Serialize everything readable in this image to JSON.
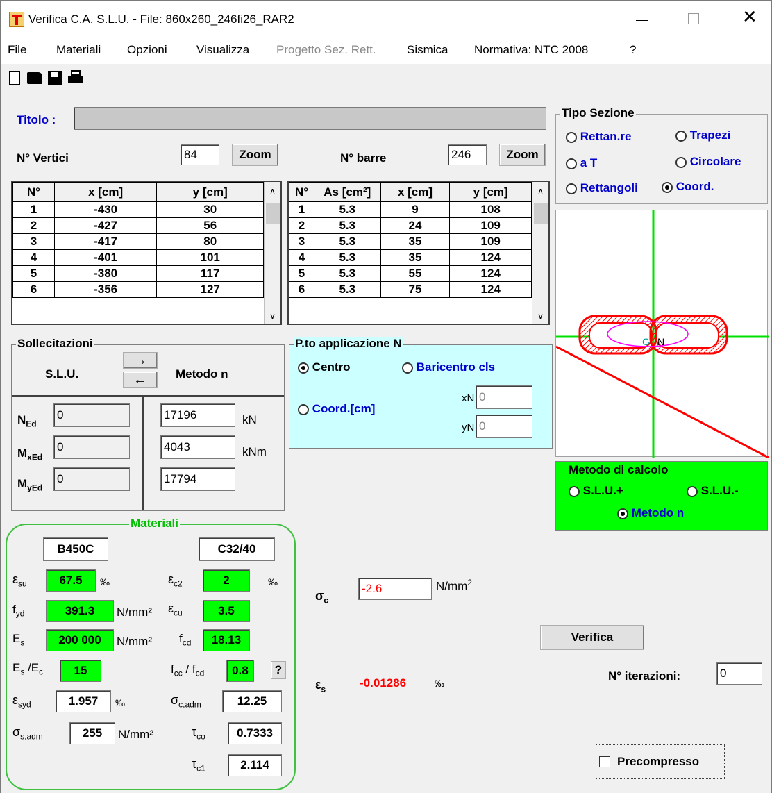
{
  "window": {
    "title": "Verifica C.A. S.L.U. - File: 860x260_246fi26_RAR2"
  },
  "menu": [
    "File",
    "Materiali",
    "Opzioni",
    "Visualizza",
    "Progetto Sez. Rett.",
    "Sismica",
    "Normativa: NTC 2008",
    "?"
  ],
  "titolo": {
    "label": "Titolo :",
    "value": ""
  },
  "vertici": {
    "label": "N° Vertici",
    "count": "84",
    "zoom": "Zoom",
    "headers": [
      "N°",
      "x [cm]",
      "y [cm]"
    ],
    "rows": [
      [
        "1",
        "-430",
        "30"
      ],
      [
        "2",
        "-427",
        "56"
      ],
      [
        "3",
        "-417",
        "80"
      ],
      [
        "4",
        "-401",
        "101"
      ],
      [
        "5",
        "-380",
        "117"
      ],
      [
        "6",
        "-356",
        "127"
      ]
    ]
  },
  "barre": {
    "label": "N° barre",
    "count": "246",
    "zoom": "Zoom",
    "headers": [
      "N°",
      "As [cm²]",
      "x [cm]",
      "y [cm]"
    ],
    "rows": [
      [
        "1",
        "5.3",
        "9",
        "108"
      ],
      [
        "2",
        "5.3",
        "24",
        "109"
      ],
      [
        "3",
        "5.3",
        "35",
        "109"
      ],
      [
        "4",
        "5.3",
        "35",
        "124"
      ],
      [
        "5",
        "5.3",
        "55",
        "124"
      ],
      [
        "6",
        "5.3",
        "75",
        "124"
      ]
    ]
  },
  "tipo_sezione": {
    "label": "Tipo Sezione",
    "options": [
      "Rettan.re",
      "Trapezi",
      "a T",
      "Circolare",
      "Rettangoli",
      "Coord."
    ],
    "selected": "Coord."
  },
  "sollecitazioni": {
    "label": "Sollecitazioni",
    "slu": "S.L.U.",
    "metodo_n": "Metodo n",
    "ned": {
      "slu": "0",
      "n": "17196",
      "unit": "kN"
    },
    "mxed": {
      "slu": "0",
      "n": "4043",
      "unit": "kNm"
    },
    "myed": {
      "slu": "0",
      "n": "17794"
    }
  },
  "applicazione": {
    "label": "P.to applicazione N",
    "centro": "Centro",
    "baricentro": "Baricentro cls",
    "coord": "Coord.[cm]",
    "xn_label": "xN",
    "xn": "0",
    "yn_label": "yN",
    "yn": "0"
  },
  "metodo_calcolo": {
    "label": "Metodo di calcolo",
    "opt1": "S.L.U.+",
    "opt2": "S.L.U.-",
    "opt3": "Metodo n"
  },
  "section_view": {
    "g_label": "G",
    "n_label": "N"
  },
  "materiali": {
    "label": "Materiali",
    "steel": "B450C",
    "concrete": "C32/40",
    "esu": "67.5",
    "ec2": "2",
    "fyd": "391.3",
    "ecu": "3.5",
    "es": "200 000",
    "fcd": "18.13",
    "es_ec": "15",
    "fcc_fcd": "0.8",
    "help": "?",
    "esyd": "1.957",
    "sc_adm": "12.25",
    "ss_adm": "255",
    "tco": "0.7333",
    "tc1": "2.114",
    "permil": "‰",
    "nmm2": "N/mm²"
  },
  "results": {
    "sigma_c": "-2.6",
    "sigma_unit": "N/mm",
    "eps_s": "-0.01286",
    "eps_unit": "‰"
  },
  "verifica": "Verifica",
  "iterazioni": {
    "label": "N° iterazioni:",
    "value": "0"
  },
  "precompresso": "Precompresso",
  "colors": {
    "green": "#00ff00",
    "cyan": "#ccffff",
    "red": "#ff0000",
    "blue": "#0000cc"
  }
}
